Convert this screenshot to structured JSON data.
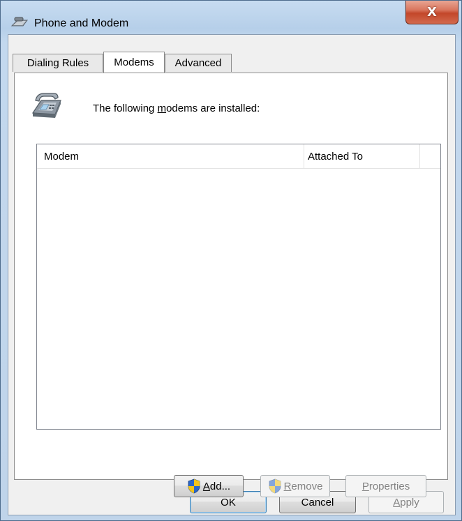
{
  "window": {
    "title": "Phone and Modem",
    "close_glyph": "X"
  },
  "tabs": [
    {
      "label": "Dialing Rules",
      "active": false
    },
    {
      "label": "Modems",
      "active": true
    },
    {
      "label": "Advanced",
      "active": false
    }
  ],
  "modems_panel": {
    "info_prefix": "The following ",
    "info_accel": "m",
    "info_suffix": "odems are installed:",
    "columns": [
      "Modem",
      "Attached To"
    ],
    "rows": []
  },
  "panel_buttons": {
    "add": {
      "accel": "A",
      "rest": "dd...",
      "enabled": true
    },
    "remove": {
      "accel": "R",
      "rest": "emove",
      "enabled": false
    },
    "properties": {
      "accel": "P",
      "rest": "roperties",
      "enabled": false
    }
  },
  "dialog_buttons": {
    "ok": "OK",
    "cancel": "Cancel",
    "apply_accel": "A",
    "apply_rest": "pply"
  },
  "colors": {
    "title_bar": "#c7dcf1",
    "close_button": "#c3472a",
    "panel_bg": "#ffffff",
    "dialog_bg": "#f0f0f0"
  },
  "icons": {
    "title": "phone-modem-icon",
    "header": "telephone-icon",
    "uac": "uac-shield-icon"
  }
}
